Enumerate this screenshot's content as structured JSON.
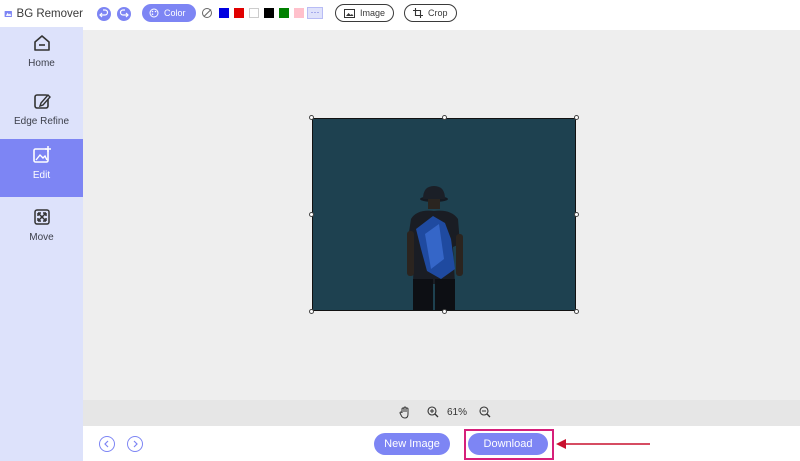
{
  "app": {
    "title": "BG Remover"
  },
  "sidebar": {
    "items": [
      {
        "label": "Home",
        "icon": "home-icon",
        "active": false
      },
      {
        "label": "Edge Refine",
        "icon": "edit-pencil-icon",
        "active": false
      },
      {
        "label": "Edit",
        "icon": "image-edit-icon",
        "active": true
      },
      {
        "label": "Move",
        "icon": "move-arrows-icon",
        "active": false
      }
    ]
  },
  "toolbar": {
    "color_label": "Color",
    "image_label": "Image",
    "crop_label": "Crop",
    "swatches": [
      "#0000e0",
      "#e00000",
      "#ffffff",
      "#000000",
      "#008000",
      "#ffc0cb"
    ],
    "more_label": "···"
  },
  "zoom": {
    "level": "61%"
  },
  "footer": {
    "new_image_label": "New Image",
    "download_label": "Download"
  },
  "colors": {
    "accent": "#7d85f4",
    "sidebar_bg": "#dde2fb",
    "canvas_bg": "#eeeeee",
    "photo_bg": "#1e4150",
    "highlight": "#d6207a",
    "arrow": "#c8102e"
  }
}
